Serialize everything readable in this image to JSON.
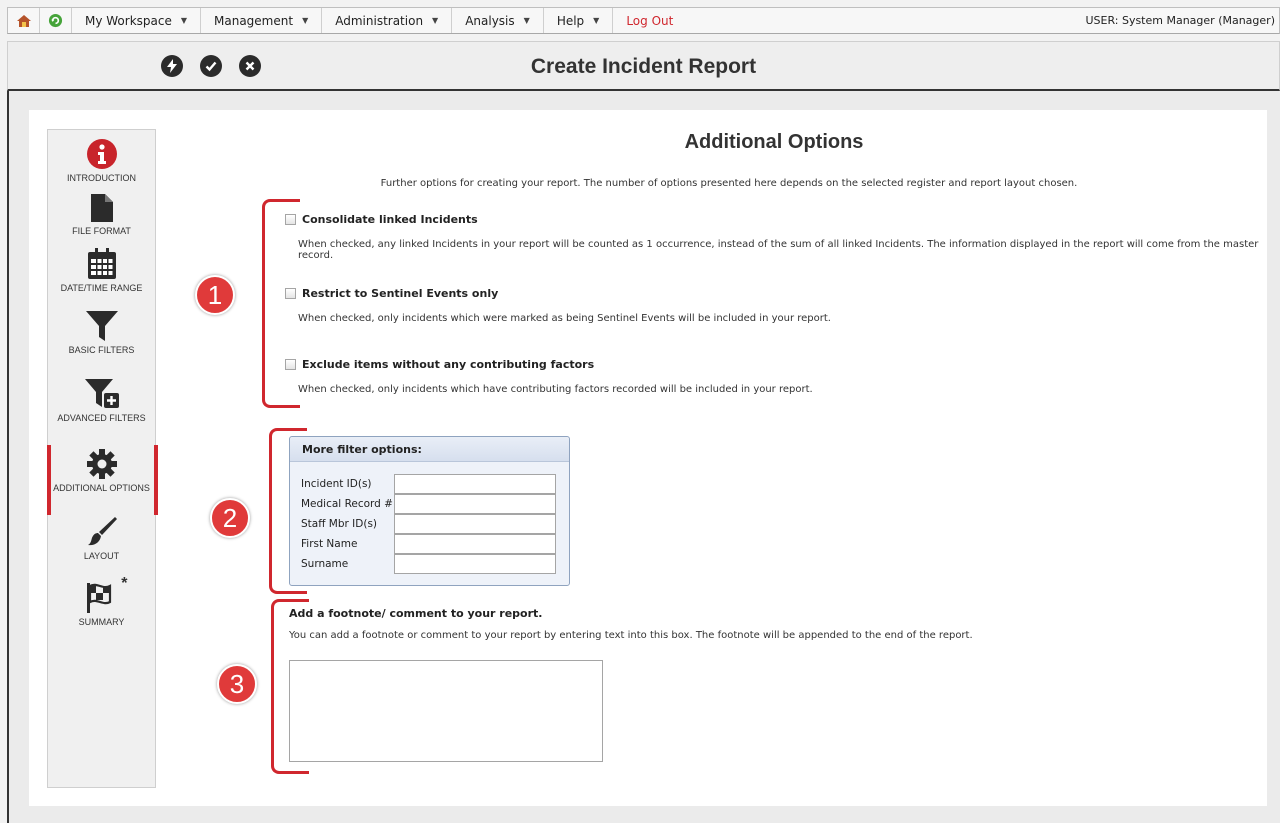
{
  "nav": {
    "items": [
      {
        "label": "My Workspace"
      },
      {
        "label": "Management"
      },
      {
        "label": "Administration"
      },
      {
        "label": "Analysis"
      },
      {
        "label": "Help"
      }
    ],
    "logout": "Log Out",
    "user": "USER: System Manager (Manager)",
    "caret": "▼"
  },
  "toolbar": {
    "title": "Create Incident Report",
    "icons": [
      "lightning-icon",
      "check-icon",
      "close-icon"
    ]
  },
  "sidebar": {
    "items": [
      {
        "label": "INTRODUCTION",
        "icon": "info-icon"
      },
      {
        "label": "FILE FORMAT",
        "icon": "file-icon"
      },
      {
        "label": "DATE/TIME RANGE",
        "icon": "calendar-icon"
      },
      {
        "label": "BASIC FILTERS",
        "icon": "filter-icon"
      },
      {
        "label": "ADVANCED FILTERS",
        "icon": "filter-plus-icon"
      },
      {
        "label": "ADDITIONAL OPTIONS",
        "icon": "gear-icon",
        "active": true
      },
      {
        "label": "LAYOUT",
        "icon": "brush-icon"
      },
      {
        "label": "SUMMARY",
        "icon": "flag-icon"
      }
    ],
    "summary_marker": "*"
  },
  "main": {
    "title": "Additional Options",
    "description": "Further options for creating your report. The number of options presented here depends on the selected register and report layout chosen.",
    "options": [
      {
        "label": "Consolidate linked Incidents",
        "description": "When checked, any linked Incidents in your report will be counted as 1 occurrence, instead of the sum of all linked Incidents. The information displayed in the report will come from the master record.",
        "checked": false
      },
      {
        "label": "Restrict to Sentinel Events only",
        "description": "When checked, only incidents which were marked as being Sentinel Events will be included in your report.",
        "checked": false
      },
      {
        "label": "Exclude items without any contributing factors",
        "description": "When checked, only incidents which have contributing factors recorded will be included in your report.",
        "checked": false
      }
    ],
    "filters": {
      "heading": "More filter options:",
      "fields": [
        {
          "label": "Incident ID(s)",
          "value": ""
        },
        {
          "label": "Medical Record #",
          "value": ""
        },
        {
          "label": "Staff Mbr ID(s)",
          "value": ""
        },
        {
          "label": "First Name",
          "value": ""
        },
        {
          "label": "Surname",
          "value": ""
        }
      ]
    },
    "footnote": {
      "title": "Add a footnote/ comment to your report.",
      "description": "You can add a footnote or comment to your report by entering text into this box. The footnote will be appended to the end of the report.",
      "value": ""
    },
    "callouts": [
      "1",
      "2",
      "3"
    ]
  },
  "colors": {
    "accent": "#d0272e",
    "callout": "#e03a3a"
  }
}
